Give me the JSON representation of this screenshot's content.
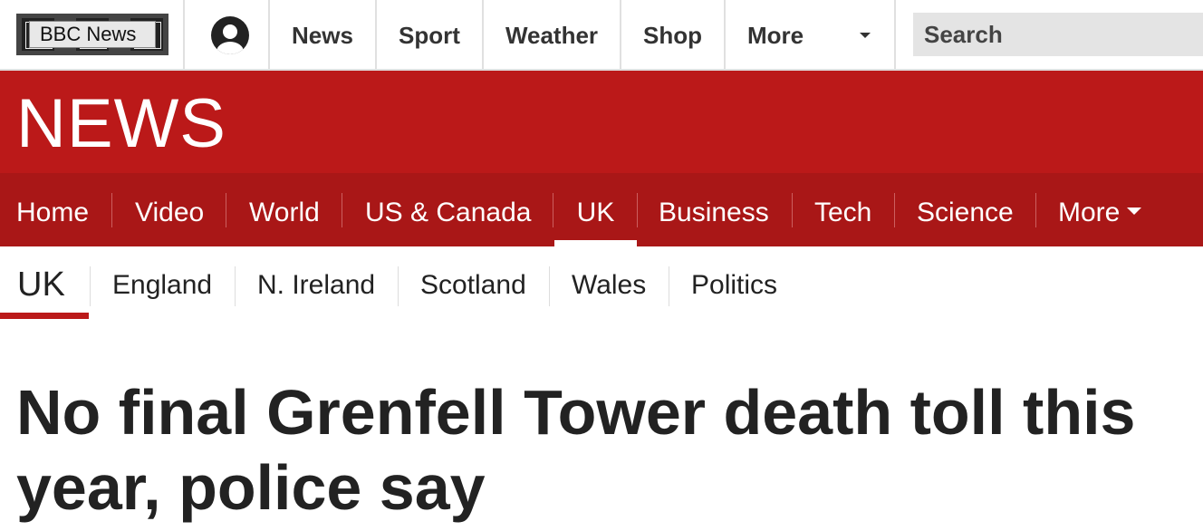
{
  "global_bar": {
    "logo_text": "BBC News",
    "account_icon": "user-icon",
    "links": [
      "News",
      "Sport",
      "Weather",
      "Shop",
      "More"
    ],
    "more_icon": "chevron-down-icon",
    "search_placeholder": "Search"
  },
  "masthead": {
    "title": "NEWS",
    "brand_color": "#bb1919"
  },
  "main_nav": {
    "items": [
      "Home",
      "Video",
      "World",
      "US & Canada",
      "UK",
      "Business",
      "Tech",
      "Science",
      "More"
    ],
    "active": "UK"
  },
  "sub_nav": {
    "current": "UK",
    "items": [
      "England",
      "N. Ireland",
      "Scotland",
      "Wales",
      "Politics"
    ]
  },
  "article": {
    "headline": "No final Grenfell Tower death toll this year, police say"
  }
}
